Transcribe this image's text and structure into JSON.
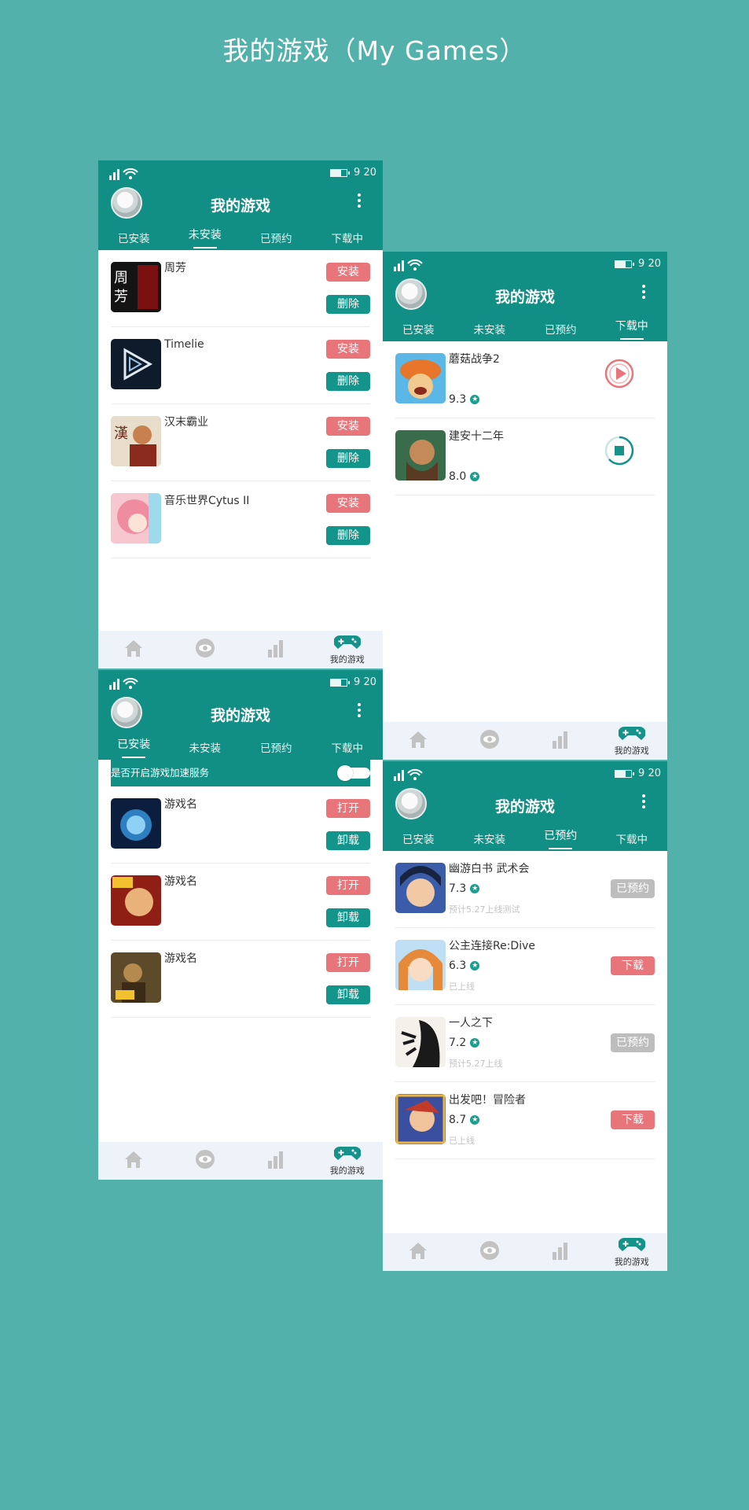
{
  "page_title": "我的游戏（My Games）",
  "status": {
    "time": "9 20"
  },
  "appbar": {
    "title": "我的游戏"
  },
  "tabs": [
    "已安装",
    "未安装",
    "已预约",
    "下载中"
  ],
  "bottom_nav": {
    "mygames_label": "我的游戏"
  },
  "colors": {
    "primary": "#128f84",
    "background": "#52b1ab",
    "red": "#e8757a",
    "gray": "#bdbdbd"
  },
  "screen_not_installed": {
    "active_tab": "未安装",
    "items": [
      {
        "name": "周芳",
        "primary_action": "安装",
        "secondary_action": "删除",
        "icon": "zhoufang-game-icon"
      },
      {
        "name": "Timelie",
        "primary_action": "安装",
        "secondary_action": "删除",
        "icon": "timelie-game-icon"
      },
      {
        "name": "汉末霸业",
        "primary_action": "安装",
        "secondary_action": "删除",
        "icon": "hanmo-game-icon"
      },
      {
        "name": "音乐世界Cytus II",
        "primary_action": "安装",
        "secondary_action": "删除",
        "icon": "cytus-game-icon"
      }
    ]
  },
  "screen_installed": {
    "active_tab": "已安装",
    "toggle_label": "是否开启游戏加速服务",
    "items": [
      {
        "name": "游戏名",
        "primary_action": "打开",
        "secondary_action": "卸载",
        "icon": "game-icon"
      },
      {
        "name": "游戏名",
        "primary_action": "打开",
        "secondary_action": "卸载",
        "icon": "game-icon"
      },
      {
        "name": "游戏名",
        "primary_action": "打开",
        "secondary_action": "卸载",
        "icon": "game-icon"
      }
    ]
  },
  "screen_downloading": {
    "active_tab": "下载中",
    "items": [
      {
        "name": "蘑菇战争2",
        "score": "9.3",
        "state": "paused",
        "icon": "play-icon"
      },
      {
        "name": "建安十二年",
        "score": "8.0",
        "state": "downloading",
        "icon": "stop-icon"
      }
    ]
  },
  "screen_reserved": {
    "active_tab": "已预约",
    "items": [
      {
        "name": "幽游白书 武术会",
        "score": "7.3",
        "sub": "预计5.27上线测试",
        "action": "已预约",
        "action_style": "gray"
      },
      {
        "name": "公主连接Re:Dive",
        "score": "6.3",
        "sub": "已上线",
        "action": "下载",
        "action_style": "red"
      },
      {
        "name": "一人之下",
        "score": "7.2",
        "sub": "预计5.27上线",
        "action": "已预约",
        "action_style": "gray"
      },
      {
        "name": "出发吧！冒险者",
        "score": "8.7",
        "sub": "已上线",
        "action": "下载",
        "action_style": "red"
      }
    ]
  }
}
